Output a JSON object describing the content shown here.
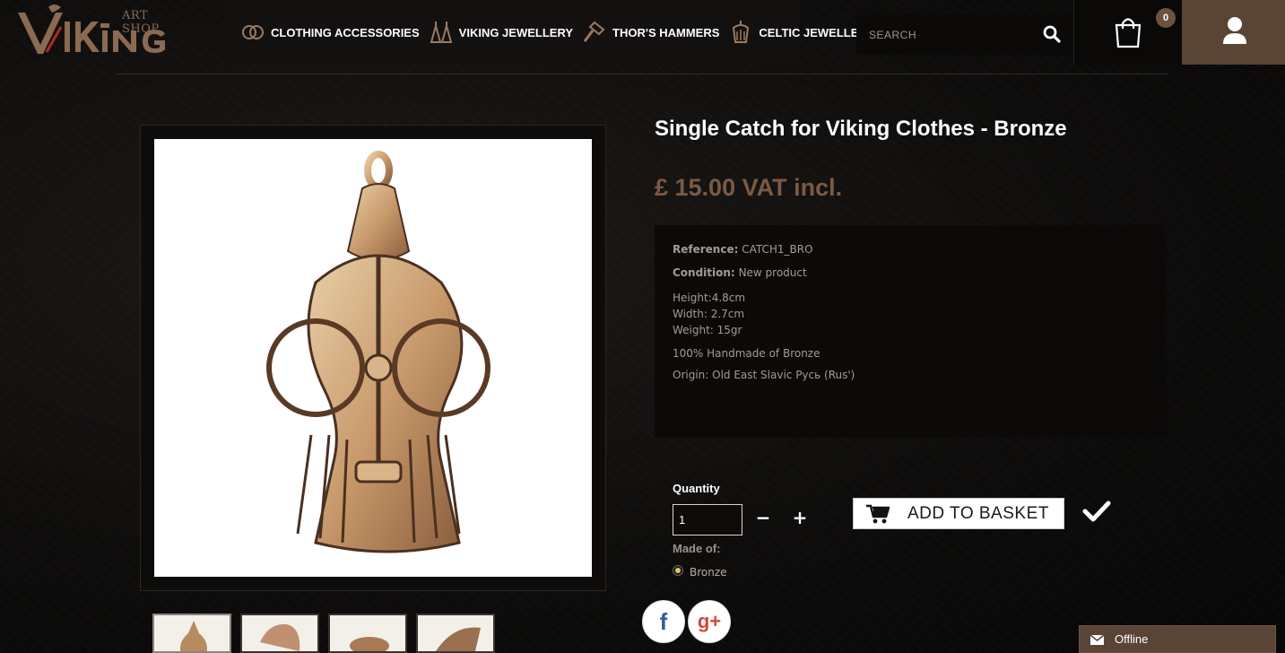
{
  "header": {
    "logo": {
      "main": "Viking",
      "sub": "ART SHOP"
    },
    "nav": [
      {
        "label": "CLOTHING ACCESSORIES",
        "icon": "rings-icon"
      },
      {
        "label": "VIKING JEWELLERY",
        "icon": "earrings-icon"
      },
      {
        "label": "THOR'S HAMMERS",
        "icon": "hammer-icon"
      },
      {
        "label": "CELTIC JEWELLERY",
        "icon": "celtic-pendant-icon"
      }
    ],
    "search": {
      "placeholder": "SEARCH",
      "value": ""
    },
    "cart": {
      "count": "0"
    }
  },
  "product": {
    "title": "Single Catch for Viking Clothes - Bronze",
    "price": "£ 15.00 VAT incl.",
    "reference_label": "Reference:",
    "reference": "CATCH1_BRO",
    "condition_label": "Condition:",
    "condition": "New product",
    "spec_height": "Height:4.8cm",
    "spec_width": "Width: 2.7cm",
    "spec_weight": "Weight: 15gr",
    "material_text": "100% Handmade of Bronze",
    "origin_text": "Origin: Old East Slavic Русь (Rus')"
  },
  "purchase": {
    "quantity_label": "Quantity",
    "quantity_value": "1",
    "minus": "−",
    "plus": "+",
    "add_label": "ADD TO BASKET",
    "made_of_label": "Made of:",
    "material_option": "Bronze"
  },
  "social": {
    "facebook": "f",
    "googleplus": "g+"
  },
  "chat": {
    "status": "Offline"
  },
  "colors": {
    "accent": "#7b5a45",
    "account_bg": "#5a4436",
    "badge": "#6d513f"
  }
}
